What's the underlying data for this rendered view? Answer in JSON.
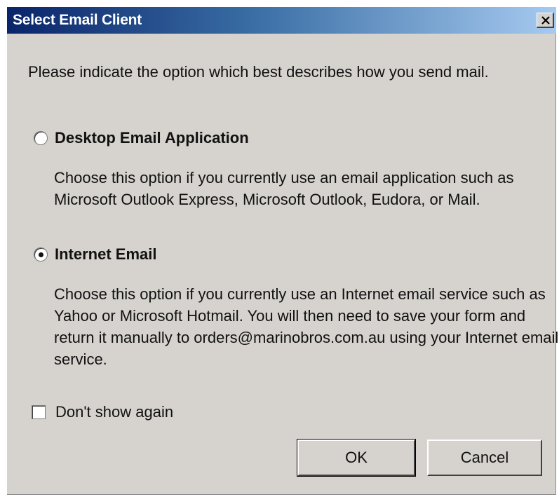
{
  "dialog": {
    "title": "Select Email Client",
    "close_icon": "close-icon"
  },
  "intro_text": "Please indicate the option which best describes how you send mail.",
  "options": [
    {
      "label": "Desktop Email Application",
      "description": "Choose this option if you currently use an email application such as Microsoft Outlook Express, Microsoft Outlook, Eudora, or Mail.",
      "selected": false
    },
    {
      "label": "Internet Email",
      "description": "Choose this option if you currently use an Internet email service such as Yahoo or Microsoft Hotmail. You will then need to save your form and return it manually to orders@marinobros.com.au using your Internet email service.",
      "selected": true
    }
  ],
  "dont_show_again": {
    "label": "Don't show again",
    "checked": false
  },
  "buttons": {
    "ok_label": "OK",
    "cancel_label": "Cancel"
  },
  "colors": {
    "titlebar_start": "#0a246a",
    "titlebar_end": "#a6caf0",
    "dialog_background": "#d6d3ce"
  }
}
